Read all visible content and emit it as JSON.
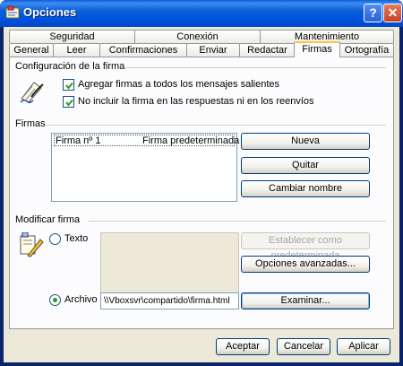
{
  "window": {
    "title": "Opciones",
    "help_label": "?",
    "close_label": "✕"
  },
  "tabs": {
    "row1": [
      "Seguridad",
      "Conexión",
      "Mantenimiento"
    ],
    "row2": [
      "General",
      "Leer",
      "Confirmaciones",
      "Enviar",
      "Redactar",
      "Firmas",
      "Ortografía"
    ],
    "active": "Firmas"
  },
  "config": {
    "legend": "Configuración de la firma",
    "cb1_label": "Agregar firmas a todos los mensajes salientes",
    "cb1_checked": true,
    "cb2_label": "No incluir la firma en las respuestas ni en los reenvíos",
    "cb2_checked": true
  },
  "firmas": {
    "legend": "Firmas",
    "list": [
      {
        "name": "Firma nº 1",
        "note": "Firma predeterminada"
      }
    ],
    "nueva": "Nueva",
    "quitar": "Quitar",
    "cambiar": "Cambiar nombre"
  },
  "modificar": {
    "legend": "Modificar firma",
    "texto": "Texto",
    "archivo": "Archivo",
    "selected": "Archivo",
    "establecer": "Establecer como predeterminada",
    "opciones_avanzadas": "Opciones avanzadas...",
    "path": "\\\\Vboxsvr\\compartido\\firma.html",
    "examinar": "Examinar..."
  },
  "footer": {
    "aceptar": "Aceptar",
    "cancelar": "Cancelar",
    "aplicar": "Aplicar"
  },
  "icons": [
    "options-icon",
    "signature-pen-icon",
    "document-edit-icon",
    "help-icon",
    "close-icon"
  ],
  "colors": {
    "title_bar": "#0a5fd8",
    "dialog_bg": "#ece9d8",
    "tab_highlight": "#ffc83c",
    "close": "#c9431f"
  }
}
